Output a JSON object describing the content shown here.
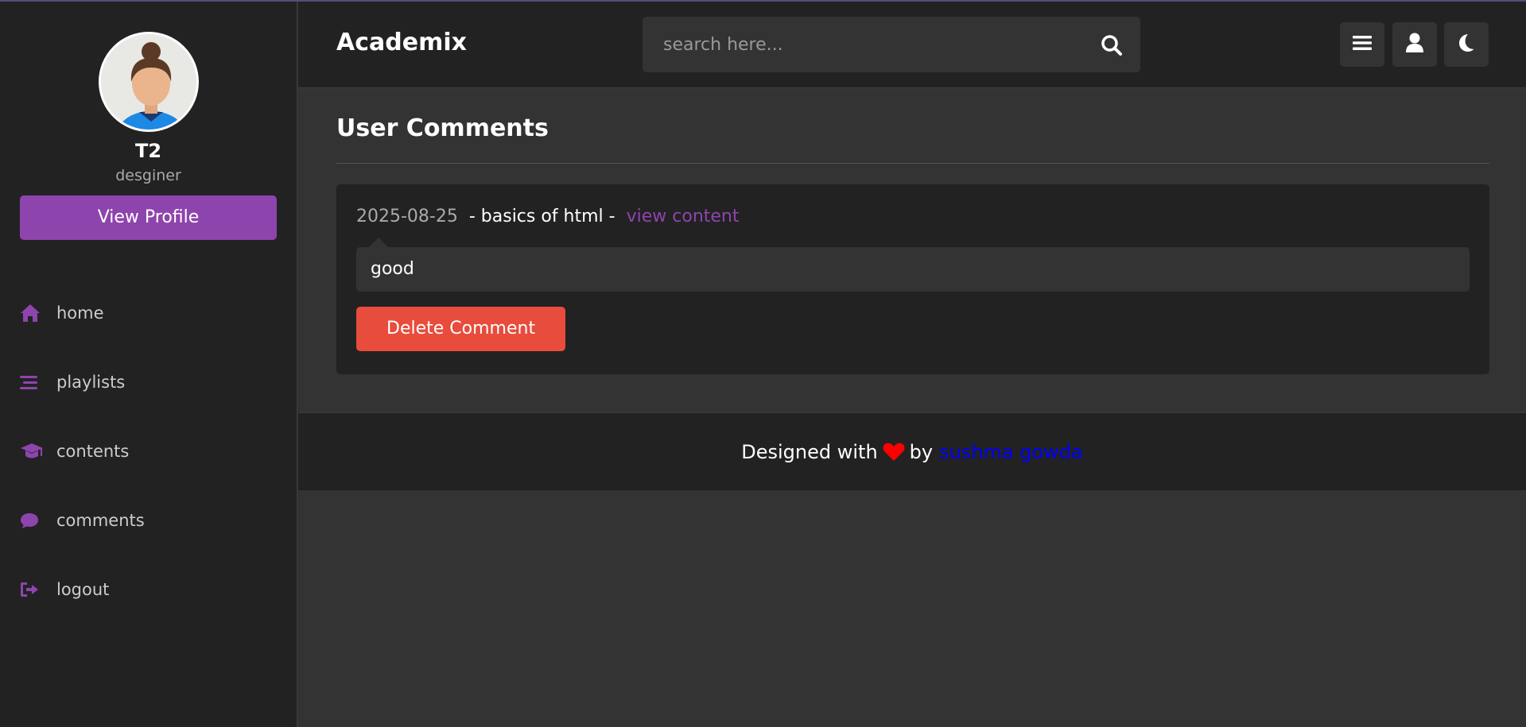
{
  "sidebar": {
    "profile": {
      "name": "T2",
      "role": "desginer",
      "button": "View Profile"
    },
    "nav": [
      {
        "label": "home",
        "icon": "home-icon"
      },
      {
        "label": "playlists",
        "icon": "bars-icon"
      },
      {
        "label": "contents",
        "icon": "graduation-cap-icon"
      },
      {
        "label": "comments",
        "icon": "comment-icon"
      },
      {
        "label": "logout",
        "icon": "sign-out-icon"
      }
    ]
  },
  "header": {
    "logo": "Academix",
    "search_placeholder": "search here...",
    "buttons": [
      "menu-icon",
      "user-icon",
      "moon-icon"
    ]
  },
  "main": {
    "heading": "User Comments",
    "comment": {
      "date": "2025-08-25",
      "title": "- basics of html -",
      "link": "view content",
      "text": "good",
      "delete": "Delete Comment"
    }
  },
  "footer": {
    "prefix": "Designed with",
    "by": "by",
    "author": "sushma gowda"
  },
  "colors": {
    "accent": "#8e44ad",
    "danger": "#e74c3c",
    "sidebar_bg": "#222222",
    "page_bg": "#333333",
    "link_blue": "#0000ff",
    "heart": "#ff0000"
  }
}
